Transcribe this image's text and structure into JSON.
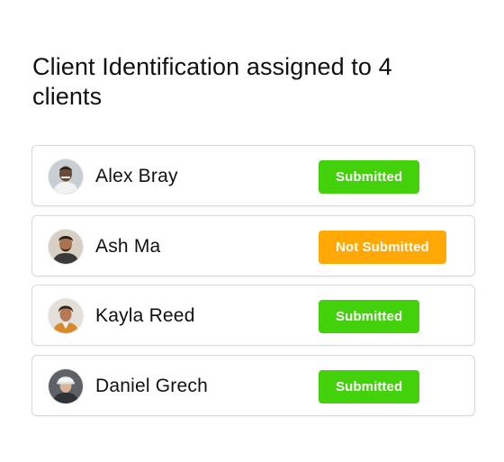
{
  "title": "Client Identification assigned to 4 clients",
  "colors": {
    "submitted": "#43d10c",
    "not_submitted": "#ffa806",
    "card_border": "#d9d9d9"
  },
  "clients": [
    {
      "name": "Alex Bray",
      "status": "Submitted",
      "state": "submitted",
      "avatar_icon": "person-photo-icon"
    },
    {
      "name": "Ash Ma",
      "status": "Not Submitted",
      "state": "not_submitted",
      "avatar_icon": "person-photo-icon"
    },
    {
      "name": "Kayla Reed",
      "status": "Submitted",
      "state": "submitted",
      "avatar_icon": "person-photo-icon"
    },
    {
      "name": "Daniel Grech",
      "status": "Submitted",
      "state": "submitted",
      "avatar_icon": "person-photo-icon"
    }
  ]
}
